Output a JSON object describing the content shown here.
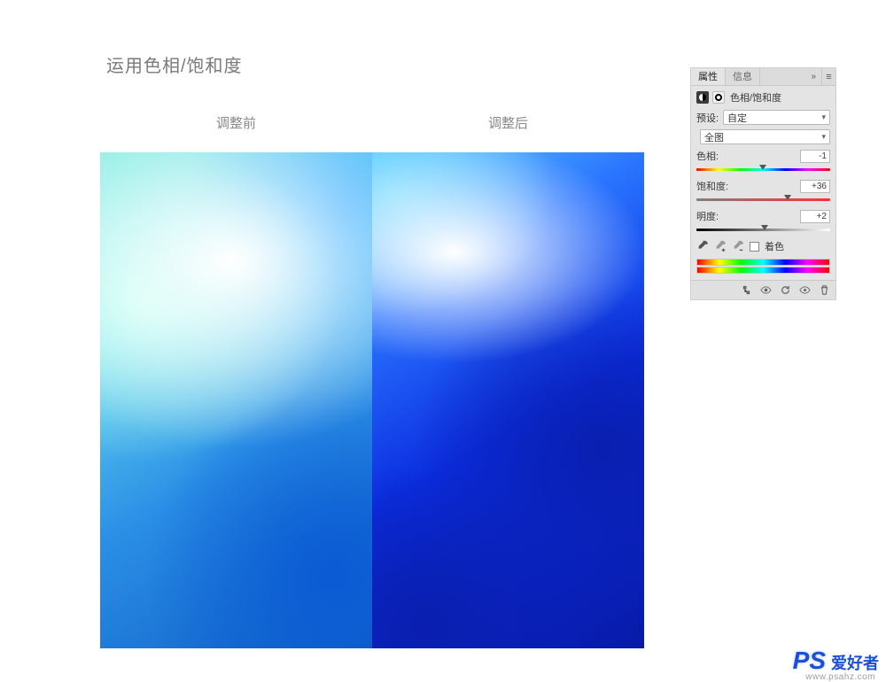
{
  "title": "运用色相/饱和度",
  "labels": {
    "before": "调整前",
    "after": "调整后"
  },
  "panel": {
    "tabs": {
      "properties": "属性",
      "info": "信息",
      "collapse": "»",
      "menu": "≡"
    },
    "adjustment_name": "色相/饱和度",
    "preset": {
      "label": "预设:",
      "value": "自定"
    },
    "range": {
      "label": "",
      "value": "全图"
    },
    "hue": {
      "label": "色相:",
      "value": "-1",
      "percent": 49.6
    },
    "saturation": {
      "label": "饱和度:",
      "value": "+36",
      "percent": 68
    },
    "lightness": {
      "label": "明度:",
      "value": "+2",
      "percent": 51
    },
    "colorize": "着色"
  },
  "watermark": {
    "logo": "PS",
    "cn": "爱好者",
    "url": "www.psahz.com"
  }
}
